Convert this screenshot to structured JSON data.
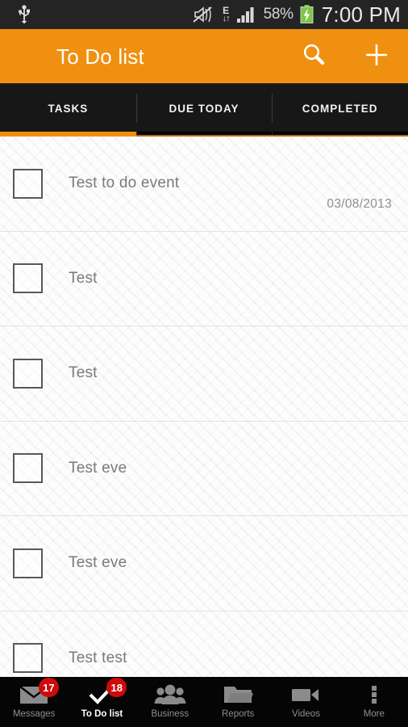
{
  "statusbar": {
    "usb_icon": "usb-icon",
    "mute_icon": "volume-muted-icon",
    "network_type": "E",
    "data_arrows": "↓↑",
    "signal_icon": "signal-bars-icon",
    "battery_percent": "58%",
    "battery_icon": "battery-charging-icon",
    "clock": "7:00 PM"
  },
  "actionbar": {
    "title": "To Do list",
    "search_icon": "search-icon",
    "add_icon": "plus-icon",
    "background": "#F09010"
  },
  "tabs": {
    "items": [
      {
        "label": "TASKS",
        "active": true
      },
      {
        "label": "DUE TODAY",
        "active": false
      },
      {
        "label": "COMPLETED",
        "active": false
      }
    ],
    "indicator_color": "#F09010"
  },
  "tasks": [
    {
      "title": "Test to do event",
      "date": "03/08/2013",
      "checked": false
    },
    {
      "title": "Test",
      "date": "",
      "checked": false
    },
    {
      "title": "Test",
      "date": "",
      "checked": false
    },
    {
      "title": "Test eve",
      "date": "",
      "checked": false
    },
    {
      "title": "Test eve",
      "date": "",
      "checked": false
    },
    {
      "title": "Test test",
      "date": "",
      "checked": false
    }
  ],
  "bottomnav": {
    "items": [
      {
        "label": "Messages",
        "icon": "envelope-icon",
        "badge": "17",
        "active": false
      },
      {
        "label": "To Do list",
        "icon": "checkmark-icon",
        "badge": "18",
        "active": true
      },
      {
        "label": "Business",
        "icon": "people-group-icon",
        "badge": "",
        "active": false
      },
      {
        "label": "Reports",
        "icon": "folder-icon",
        "badge": "",
        "active": false
      },
      {
        "label": "Videos",
        "icon": "video-camera-icon",
        "badge": "",
        "active": false
      },
      {
        "label": "More",
        "icon": "overflow-dots-icon",
        "badge": "",
        "active": false
      }
    ],
    "badge_color": "#CF0A0A"
  }
}
